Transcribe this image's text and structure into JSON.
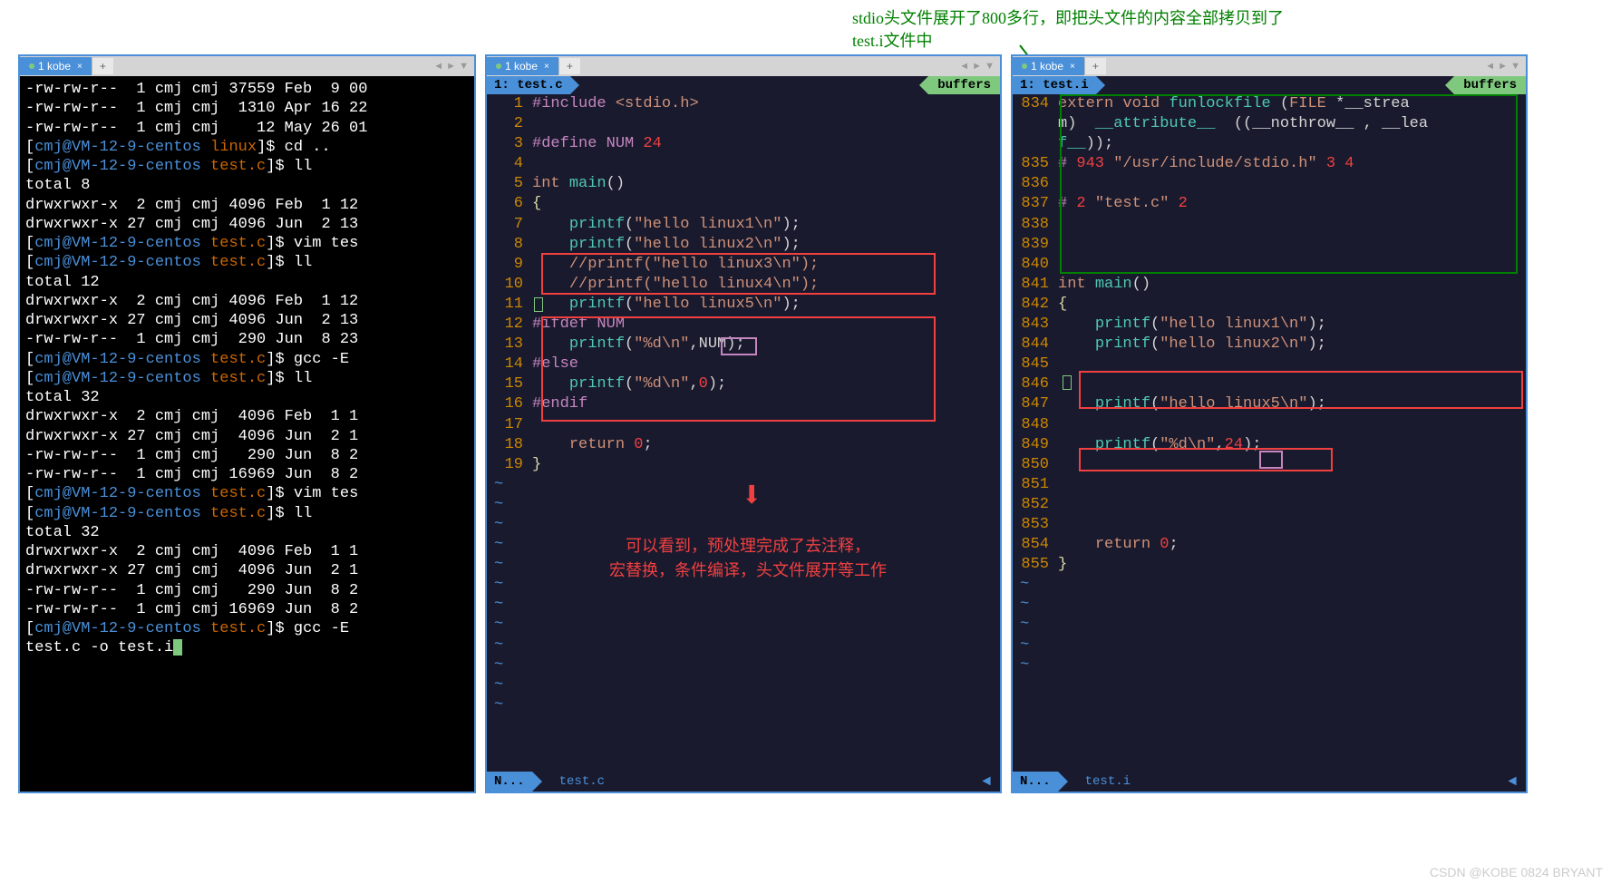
{
  "top_annotation": {
    "line1": "stdio头文件展开了800多行，即把头文件的内容全部拷贝到了",
    "line2": "test.i文件中"
  },
  "tabs": {
    "left": "1 kobe",
    "mid": "1 kobe",
    "right": "1 kobe",
    "add": "+"
  },
  "pane_mid": {
    "header_left": "1: test.c",
    "header_right": "buffers",
    "status_left": "N...",
    "status_file": "test.c",
    "lines": [
      {
        "n": "1",
        "tokens": [
          {
            "t": "#include ",
            "c": "kw-purple"
          },
          {
            "t": "<stdio.h>",
            "c": "kw-orange"
          }
        ]
      },
      {
        "n": "2",
        "tokens": []
      },
      {
        "n": "3",
        "tokens": [
          {
            "t": "#define NUM ",
            "c": "kw-purple"
          },
          {
            "t": "24",
            "c": "kw-red"
          }
        ]
      },
      {
        "n": "4",
        "tokens": []
      },
      {
        "n": "5",
        "tokens": [
          {
            "t": "int",
            "c": "kw-orange"
          },
          {
            "t": " ",
            "c": ""
          },
          {
            "t": "main",
            "c": "kw-cyan"
          },
          {
            "t": "()",
            "c": "kw-white"
          }
        ]
      },
      {
        "n": "6",
        "tokens": [
          {
            "t": "{",
            "c": "kw-brace"
          }
        ]
      },
      {
        "n": "7",
        "tokens": [
          {
            "t": "    ",
            "c": ""
          },
          {
            "t": "printf",
            "c": "kw-cyan"
          },
          {
            "t": "(",
            "c": "kw-white"
          },
          {
            "t": "\"hello linux1\\n\"",
            "c": "kw-orange"
          },
          {
            "t": ");",
            "c": "kw-white"
          }
        ]
      },
      {
        "n": "8",
        "tokens": [
          {
            "t": "    ",
            "c": ""
          },
          {
            "t": "printf",
            "c": "kw-cyan"
          },
          {
            "t": "(",
            "c": "kw-white"
          },
          {
            "t": "\"hello linux2\\n\"",
            "c": "kw-orange"
          },
          {
            "t": ");",
            "c": "kw-white"
          }
        ]
      },
      {
        "n": "9",
        "tokens": [
          {
            "t": "    ",
            "c": ""
          },
          {
            "t": "//printf(\"hello linux3\\n\");",
            "c": "kw-comment"
          }
        ]
      },
      {
        "n": "10",
        "tokens": [
          {
            "t": "    ",
            "c": ""
          },
          {
            "t": "//printf(\"hello linux4\\n\");",
            "c": "kw-comment"
          }
        ]
      },
      {
        "n": "11",
        "tokens": [
          {
            "t": "    ",
            "c": ""
          },
          {
            "t": "printf",
            "c": "kw-cyan"
          },
          {
            "t": "(",
            "c": "kw-white"
          },
          {
            "t": "\"hello linux5\\n\"",
            "c": "kw-orange"
          },
          {
            "t": ");",
            "c": "kw-white"
          }
        ]
      },
      {
        "n": "12",
        "tokens": [
          {
            "t": "#ifdef NUM",
            "c": "kw-purple"
          }
        ]
      },
      {
        "n": "13",
        "tokens": [
          {
            "t": "    ",
            "c": ""
          },
          {
            "t": "printf",
            "c": "kw-cyan"
          },
          {
            "t": "(",
            "c": "kw-white"
          },
          {
            "t": "\"%d\\n\"",
            "c": "kw-orange"
          },
          {
            "t": ",",
            "c": "kw-white"
          },
          {
            "t": "NUM",
            "c": "kw-white"
          },
          {
            "t": ");",
            "c": "kw-white"
          }
        ]
      },
      {
        "n": "14",
        "tokens": [
          {
            "t": "#else",
            "c": "kw-purple"
          }
        ]
      },
      {
        "n": "15",
        "tokens": [
          {
            "t": "    ",
            "c": ""
          },
          {
            "t": "printf",
            "c": "kw-cyan"
          },
          {
            "t": "(",
            "c": "kw-white"
          },
          {
            "t": "\"%d\\n\"",
            "c": "kw-orange"
          },
          {
            "t": ",",
            "c": "kw-white"
          },
          {
            "t": "0",
            "c": "kw-red"
          },
          {
            "t": ");",
            "c": "kw-white"
          }
        ]
      },
      {
        "n": "16",
        "tokens": [
          {
            "t": "#endif",
            "c": "kw-purple"
          }
        ]
      },
      {
        "n": "17",
        "tokens": []
      },
      {
        "n": "18",
        "tokens": [
          {
            "t": "    ",
            "c": ""
          },
          {
            "t": "return",
            "c": "kw-orange"
          },
          {
            "t": " ",
            "c": ""
          },
          {
            "t": "0",
            "c": "kw-red"
          },
          {
            "t": ";",
            "c": "kw-white"
          }
        ]
      },
      {
        "n": "19",
        "tokens": [
          {
            "t": "}",
            "c": "kw-brace"
          }
        ]
      }
    ],
    "annotation": {
      "line1": "可以看到，预处理完成了去注释，",
      "line2": "宏替换，条件编译，头文件展开等工作"
    }
  },
  "pane_right": {
    "header_left": "1: test.i",
    "header_right": "buffers",
    "status_left": "N...",
    "status_file": "test.i",
    "lines": [
      {
        "n": "834",
        "tokens": [
          {
            "t": "extern",
            "c": "kw-orange"
          },
          {
            "t": " ",
            "c": ""
          },
          {
            "t": "void",
            "c": "kw-orange"
          },
          {
            "t": " ",
            "c": ""
          },
          {
            "t": "funlockfile",
            "c": "kw-cyan"
          },
          {
            "t": " (",
            "c": "kw-white"
          },
          {
            "t": "FILE",
            "c": "kw-orange"
          },
          {
            "t": " *__strea",
            "c": "kw-white"
          }
        ]
      },
      {
        "n": "",
        "tokens": [
          {
            "t": "m)  ",
            "c": "kw-white"
          },
          {
            "t": "__attribute__",
            "c": "kw-cyan"
          },
          {
            "t": "  ((__nothrow__ , __lea",
            "c": "kw-white"
          }
        ]
      },
      {
        "n": "",
        "tokens": [
          {
            "t": "f__",
            "c": "kw-cyan"
          },
          {
            "t": "));",
            "c": "kw-white"
          }
        ]
      },
      {
        "n": "835",
        "tokens": [
          {
            "t": "# ",
            "c": "kw-purple"
          },
          {
            "t": "943",
            "c": "kw-red"
          },
          {
            "t": " ",
            "c": ""
          },
          {
            "t": "\"/usr/include/stdio.h\"",
            "c": "kw-orange"
          },
          {
            "t": " ",
            "c": ""
          },
          {
            "t": "3 4",
            "c": "kw-red"
          }
        ]
      },
      {
        "n": "836",
        "tokens": []
      },
      {
        "n": "837",
        "tokens": [
          {
            "t": "# ",
            "c": "kw-purple"
          },
          {
            "t": "2",
            "c": "kw-red"
          },
          {
            "t": " ",
            "c": ""
          },
          {
            "t": "\"test.c\"",
            "c": "kw-orange"
          },
          {
            "t": " ",
            "c": ""
          },
          {
            "t": "2",
            "c": "kw-red"
          }
        ]
      },
      {
        "n": "838",
        "tokens": []
      },
      {
        "n": "839",
        "tokens": []
      },
      {
        "n": "840",
        "tokens": []
      },
      {
        "n": "841",
        "tokens": [
          {
            "t": "int",
            "c": "kw-orange"
          },
          {
            "t": " ",
            "c": ""
          },
          {
            "t": "main",
            "c": "kw-cyan"
          },
          {
            "t": "()",
            "c": "kw-white"
          }
        ]
      },
      {
        "n": "842",
        "tokens": [
          {
            "t": "{",
            "c": "kw-brace"
          }
        ]
      },
      {
        "n": "843",
        "tokens": [
          {
            "t": "    ",
            "c": ""
          },
          {
            "t": "printf",
            "c": "kw-cyan"
          },
          {
            "t": "(",
            "c": "kw-white"
          },
          {
            "t": "\"hello linux1\\n\"",
            "c": "kw-orange"
          },
          {
            "t": ");",
            "c": "kw-white"
          }
        ]
      },
      {
        "n": "844",
        "tokens": [
          {
            "t": "    ",
            "c": ""
          },
          {
            "t": "printf",
            "c": "kw-cyan"
          },
          {
            "t": "(",
            "c": "kw-white"
          },
          {
            "t": "\"hello linux2\\n\"",
            "c": "kw-orange"
          },
          {
            "t": ");",
            "c": "kw-white"
          }
        ]
      },
      {
        "n": "845",
        "tokens": []
      },
      {
        "n": "846",
        "tokens": []
      },
      {
        "n": "847",
        "tokens": [
          {
            "t": "    ",
            "c": ""
          },
          {
            "t": "printf",
            "c": "kw-cyan"
          },
          {
            "t": "(",
            "c": "kw-white"
          },
          {
            "t": "\"hello linux5\\n\"",
            "c": "kw-orange"
          },
          {
            "t": ");",
            "c": "kw-white"
          }
        ]
      },
      {
        "n": "848",
        "tokens": []
      },
      {
        "n": "849",
        "tokens": [
          {
            "t": "    ",
            "c": ""
          },
          {
            "t": "printf",
            "c": "kw-cyan"
          },
          {
            "t": "(",
            "c": "kw-white"
          },
          {
            "t": "\"%d\\n\"",
            "c": "kw-orange"
          },
          {
            "t": ",",
            "c": "kw-white"
          },
          {
            "t": "24",
            "c": "kw-red"
          },
          {
            "t": ");",
            "c": "kw-white"
          }
        ]
      },
      {
        "n": "850",
        "tokens": []
      },
      {
        "n": "851",
        "tokens": []
      },
      {
        "n": "852",
        "tokens": []
      },
      {
        "n": "853",
        "tokens": []
      },
      {
        "n": "854",
        "tokens": [
          {
            "t": "    ",
            "c": ""
          },
          {
            "t": "return",
            "c": "kw-orange"
          },
          {
            "t": " ",
            "c": ""
          },
          {
            "t": "0",
            "c": "kw-red"
          },
          {
            "t": ";",
            "c": "kw-white"
          }
        ]
      },
      {
        "n": "855",
        "tokens": [
          {
            "t": "}",
            "c": "kw-brace"
          }
        ]
      }
    ]
  },
  "terminal": {
    "lines": [
      "-rw-rw-r--  1 cmj cmj 37559 Feb  9 00",
      "-rw-rw-r--  1 cmj cmj  1310 Apr 16 22",
      "-rw-rw-r--  1 cmj cmj    12 May 26 01",
      {
        "prompt": "[cmj@VM-12-9-centos linux]$",
        "cmd": " cd .."
      },
      {
        "prompt": "[cmj@VM-12-9-centos test.c]$",
        "cmd": " ll"
      },
      "total 8",
      "drwxrwxr-x  2 cmj cmj 4096 Feb  1 12",
      "drwxrwxr-x 27 cmj cmj 4096 Jun  2 13",
      {
        "prompt": "[cmj@VM-12-9-centos test.c]$",
        "cmd": " vim tes"
      },
      {
        "prompt": "[cmj@VM-12-9-centos test.c]$",
        "cmd": " ll"
      },
      "total 12",
      "drwxrwxr-x  2 cmj cmj 4096 Feb  1 12",
      "drwxrwxr-x 27 cmj cmj 4096 Jun  2 13",
      "-rw-rw-r--  1 cmj cmj  290 Jun  8 23",
      {
        "prompt": "[cmj@VM-12-9-centos test.c]$",
        "cmd": " gcc -E "
      },
      {
        "prompt": "[cmj@VM-12-9-centos test.c]$",
        "cmd": " ll"
      },
      "total 32",
      "drwxrwxr-x  2 cmj cmj  4096 Feb  1 1",
      "drwxrwxr-x 27 cmj cmj  4096 Jun  2 1",
      "-rw-rw-r--  1 cmj cmj   290 Jun  8 2",
      "-rw-rw-r--  1 cmj cmj 16969 Jun  8 2",
      {
        "prompt": "[cmj@VM-12-9-centos test.c]$",
        "cmd": " vim tes"
      },
      {
        "prompt": "[cmj@VM-12-9-centos test.c]$",
        "cmd": " ll"
      },
      "total 32",
      "drwxrwxr-x  2 cmj cmj  4096 Feb  1 1",
      "drwxrwxr-x 27 cmj cmj  4096 Jun  2 1",
      "-rw-rw-r--  1 cmj cmj   290 Jun  8 2",
      "-rw-rw-r--  1 cmj cmj 16969 Jun  8 2",
      {
        "prompt": "[cmj@VM-12-9-centos test.c]$",
        "cmd": " gcc -E "
      },
      {
        "cont": "test.c -o test.i",
        "cursor": true
      }
    ]
  },
  "watermark": "CSDN @KOBE 0824 BRYANT"
}
